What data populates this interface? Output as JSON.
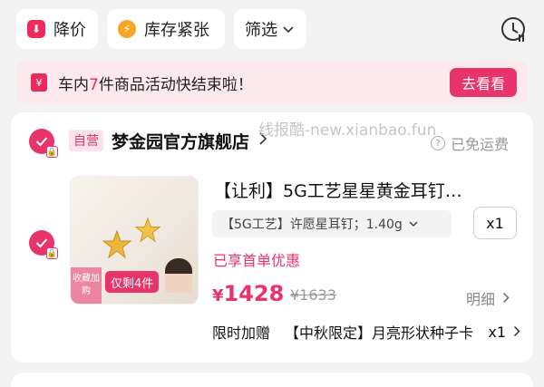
{
  "filters": [
    {
      "label": "降价",
      "icon": "price-down-icon"
    },
    {
      "label": "库存紧张",
      "icon": "lightning-icon"
    },
    {
      "label": "筛选",
      "icon": "chevron-down-icon"
    }
  ],
  "toolbar": {
    "clock_icon": "clock-icon"
  },
  "banner": {
    "text_prefix": "车内",
    "highlight": "7",
    "text_suffix": "件商品活动快结束啦！",
    "button_label": "去看看",
    "icon_glyph": "¥"
  },
  "watermark": "线报酷-new.xianbao.fun",
  "store": {
    "badge": "自营",
    "name": "梦金园官方旗舰店",
    "shipping": "已免运费"
  },
  "product": {
    "image_stock_label": "仅剩4件",
    "image_fav_label": "收藏加购",
    "title": "【让利】5G工艺星星黄金耳钉…",
    "sku": "【5G工艺】许愿星耳钉；1.40g",
    "quantity": "x1",
    "promo": "已享首单优惠",
    "currency": "¥",
    "price": "1428",
    "original_price": "¥1633",
    "detail_label": "明细"
  },
  "addon": {
    "label": "限时加赠",
    "item": "【中秋限定】月亮形状种子卡",
    "quantity": "x1"
  },
  "colors": {
    "accent": "#e8336b",
    "banner_bg": "#fbe9ee",
    "page_bg": "#f3f3f3"
  }
}
